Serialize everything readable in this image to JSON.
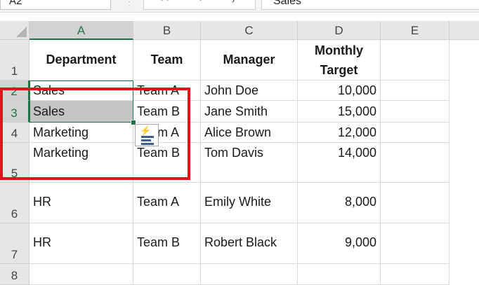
{
  "formula_bar": {
    "name_box": "A2",
    "formula": "Sales",
    "cancel_glyph": "✕",
    "enter_glyph": "✓",
    "fx_label": "fx",
    "dots": "⋮"
  },
  "columns": [
    "A",
    "B",
    "C",
    "D",
    "E"
  ],
  "rows": [
    "1",
    "2",
    "3",
    "4",
    "5",
    "6",
    "7",
    "8"
  ],
  "header": {
    "department": "Department",
    "team": "Team",
    "manager": "Manager",
    "target": "Monthly Target"
  },
  "data_rows": [
    {
      "department": "Sales",
      "team": "Team A",
      "manager": "John Doe",
      "target": "10,000"
    },
    {
      "department": "Sales",
      "team": "Team B",
      "manager": "Jane Smith",
      "target": "15,000"
    },
    {
      "department": "Marketing",
      "team": "Team A",
      "manager": "Alice Brown",
      "target": "12,000"
    },
    {
      "department": "Marketing",
      "team": "Team B",
      "manager": "Tom Davis",
      "target": "14,000"
    },
    {
      "department": "HR",
      "team": "Team A",
      "manager": "Emily White",
      "target": "8,000"
    },
    {
      "department": "HR",
      "team": "Team B",
      "manager": "Robert Black",
      "target": "9,000"
    }
  ],
  "selection": {
    "active_cell": "A2",
    "range": "A2:A3"
  },
  "colors": {
    "accent": "#217346",
    "highlight": "#e0151a",
    "selected_fill": "#c4c4c4"
  },
  "icons": [
    "close-icon",
    "check-icon",
    "fx-icon",
    "quick-analysis-icon"
  ]
}
